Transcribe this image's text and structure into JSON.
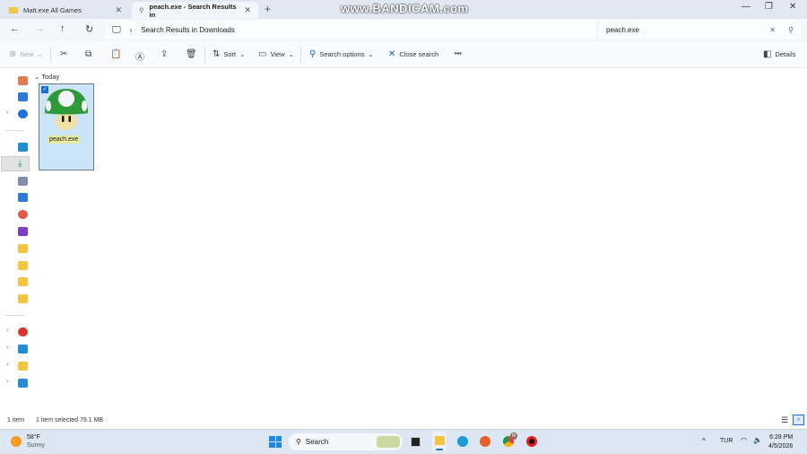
{
  "tabs": [
    {
      "label": "Matt.exe All Games"
    },
    {
      "label": "peach.exe - Search Results in"
    }
  ],
  "watermark": "www.BANDICAM.com",
  "address": {
    "path": "Search Results in Downloads",
    "search_value": "peach.exe"
  },
  "toolbar": {
    "new": "New",
    "sort": "Sort",
    "view": "View",
    "search_options": "Search options",
    "close_search": "Close search",
    "more": "•••",
    "details": "Details"
  },
  "content": {
    "group": "Today",
    "file": {
      "name": "peach.exe",
      "selected": true
    }
  },
  "status": {
    "count": "1 item",
    "selected": "1 item selected  79.1 MB"
  },
  "taskbar": {
    "weather_temp": "58°F",
    "weather_desc": "Sunny",
    "search": "Search",
    "lang": "TUR",
    "time": "6:28 PM",
    "date": "4/5/2026",
    "chrome_badge": "M"
  }
}
